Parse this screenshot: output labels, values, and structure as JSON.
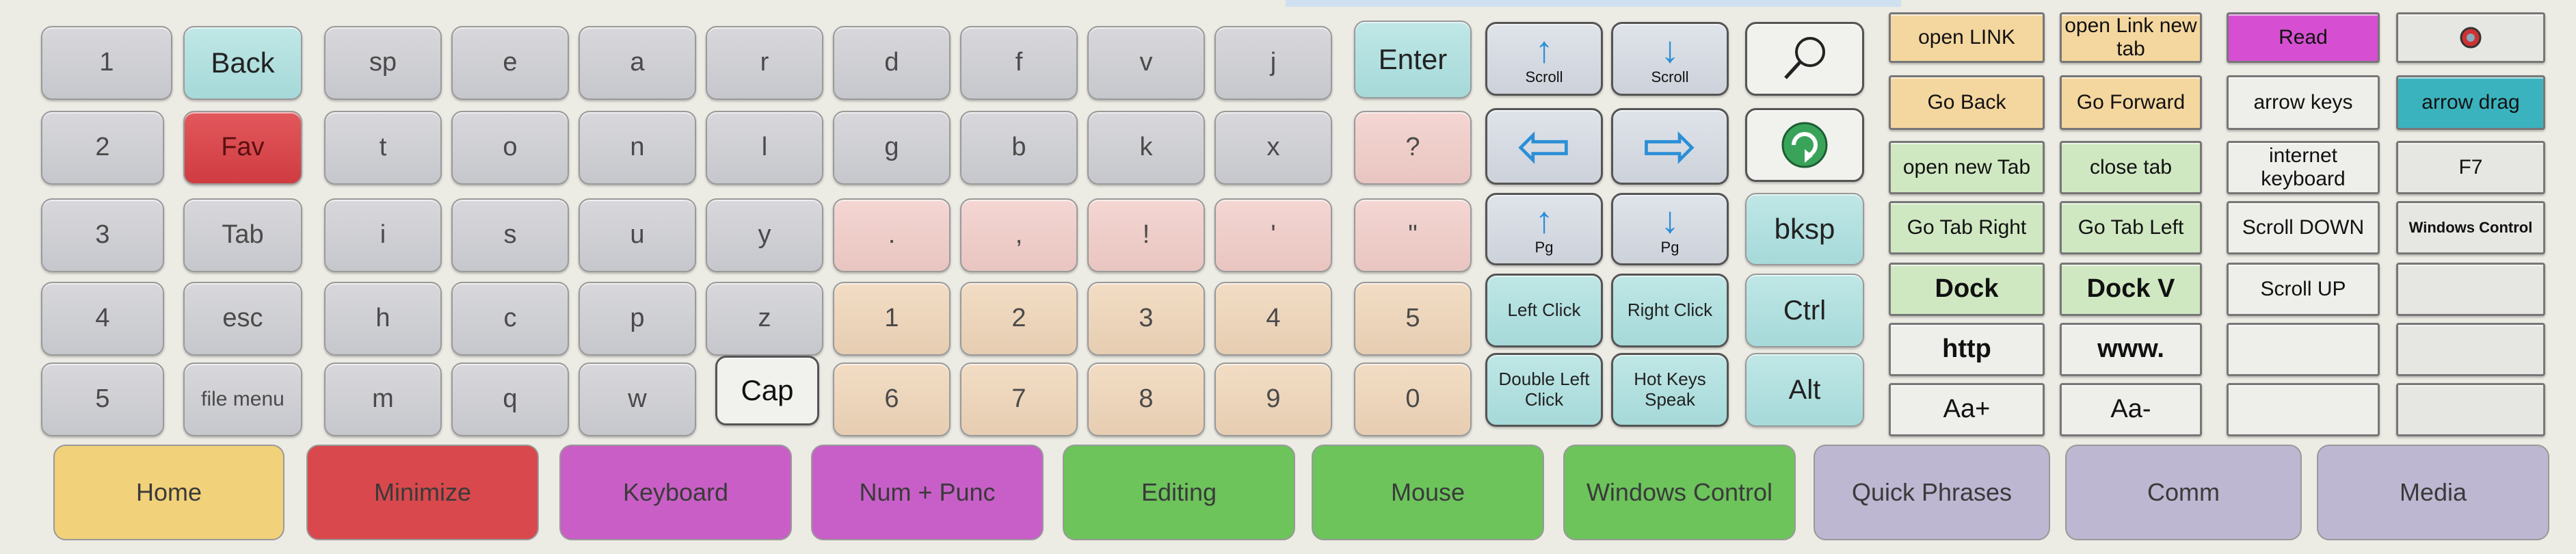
{
  "number_keys": [
    "1",
    "2",
    "3",
    "4",
    "5"
  ],
  "nav_keys": {
    "back": "Back",
    "fav": "Fav",
    "tab": "Tab",
    "esc": "esc",
    "file_menu": "file menu"
  },
  "letter_rows": [
    [
      "sp",
      "e",
      "a",
      "r",
      "d",
      "f",
      "v",
      "j"
    ],
    [
      "t",
      "o",
      "n",
      "l",
      "g",
      "b",
      "k",
      "x"
    ],
    [
      "i",
      "s",
      "u",
      "y",
      ".",
      ",",
      "!",
      "'"
    ],
    [
      "h",
      "c",
      "p",
      "z",
      "1",
      "2",
      "3",
      "4"
    ],
    [
      "m",
      "q",
      "w",
      "Cap",
      "6",
      "7",
      "8",
      "9"
    ]
  ],
  "right_col": {
    "enter": "Enter",
    "question": "?",
    "quote": "\"",
    "five": "5",
    "zero": "0"
  },
  "arrows": {
    "scroll_up": "Scroll",
    "scroll_down": "Scroll",
    "pg_up": "Pg",
    "pg_down": "Pg",
    "left_click": "Left Click",
    "right_click": "Right Click",
    "double_left_click": "Double Left Click",
    "hot_keys_speak": "Hot Keys Speak"
  },
  "tools": {
    "bksp": "bksp",
    "ctrl": "Ctrl",
    "alt": "Alt"
  },
  "browser": {
    "open_link": "open LINK",
    "open_link_new_tab": "open Link new tab",
    "read": "Read",
    "go_back": "Go Back",
    "go_forward": "Go Forward",
    "arrow_keys": "arrow keys",
    "arrow_drag": "arrow drag",
    "open_new_tab": "open new Tab",
    "close_tab": "close tab",
    "internet_keyboard": "internet keyboard",
    "f7": "F7",
    "go_tab_right": "Go Tab Right",
    "go_tab_left": "Go Tab Left",
    "scroll_down": "Scroll DOWN",
    "windows_control": "Windows Control",
    "dock": "Dock",
    "dock_v": "Dock V",
    "scroll_up": "Scroll UP",
    "http": "http",
    "www": "www.",
    "aa_plus": "Aa+",
    "aa_minus": "Aa-"
  },
  "categories": [
    {
      "label": "Home",
      "color": "#f1d17a"
    },
    {
      "label": "Minimize",
      "color": "#d9484c"
    },
    {
      "label": "Keyboard",
      "color": "#c95fc6"
    },
    {
      "label": "Num + Punc",
      "color": "#c85fc8"
    },
    {
      "label": "Editing",
      "color": "#6cc45b"
    },
    {
      "label": "Mouse",
      "color": "#6cc45b"
    },
    {
      "label": "Windows Control",
      "color": "#6cc45b"
    },
    {
      "label": "Quick Phrases",
      "color": "#bdb7d2"
    },
    {
      "label": "Comm",
      "color": "#bdb7d2"
    },
    {
      "label": "Media",
      "color": "#bdb7d2"
    }
  ]
}
